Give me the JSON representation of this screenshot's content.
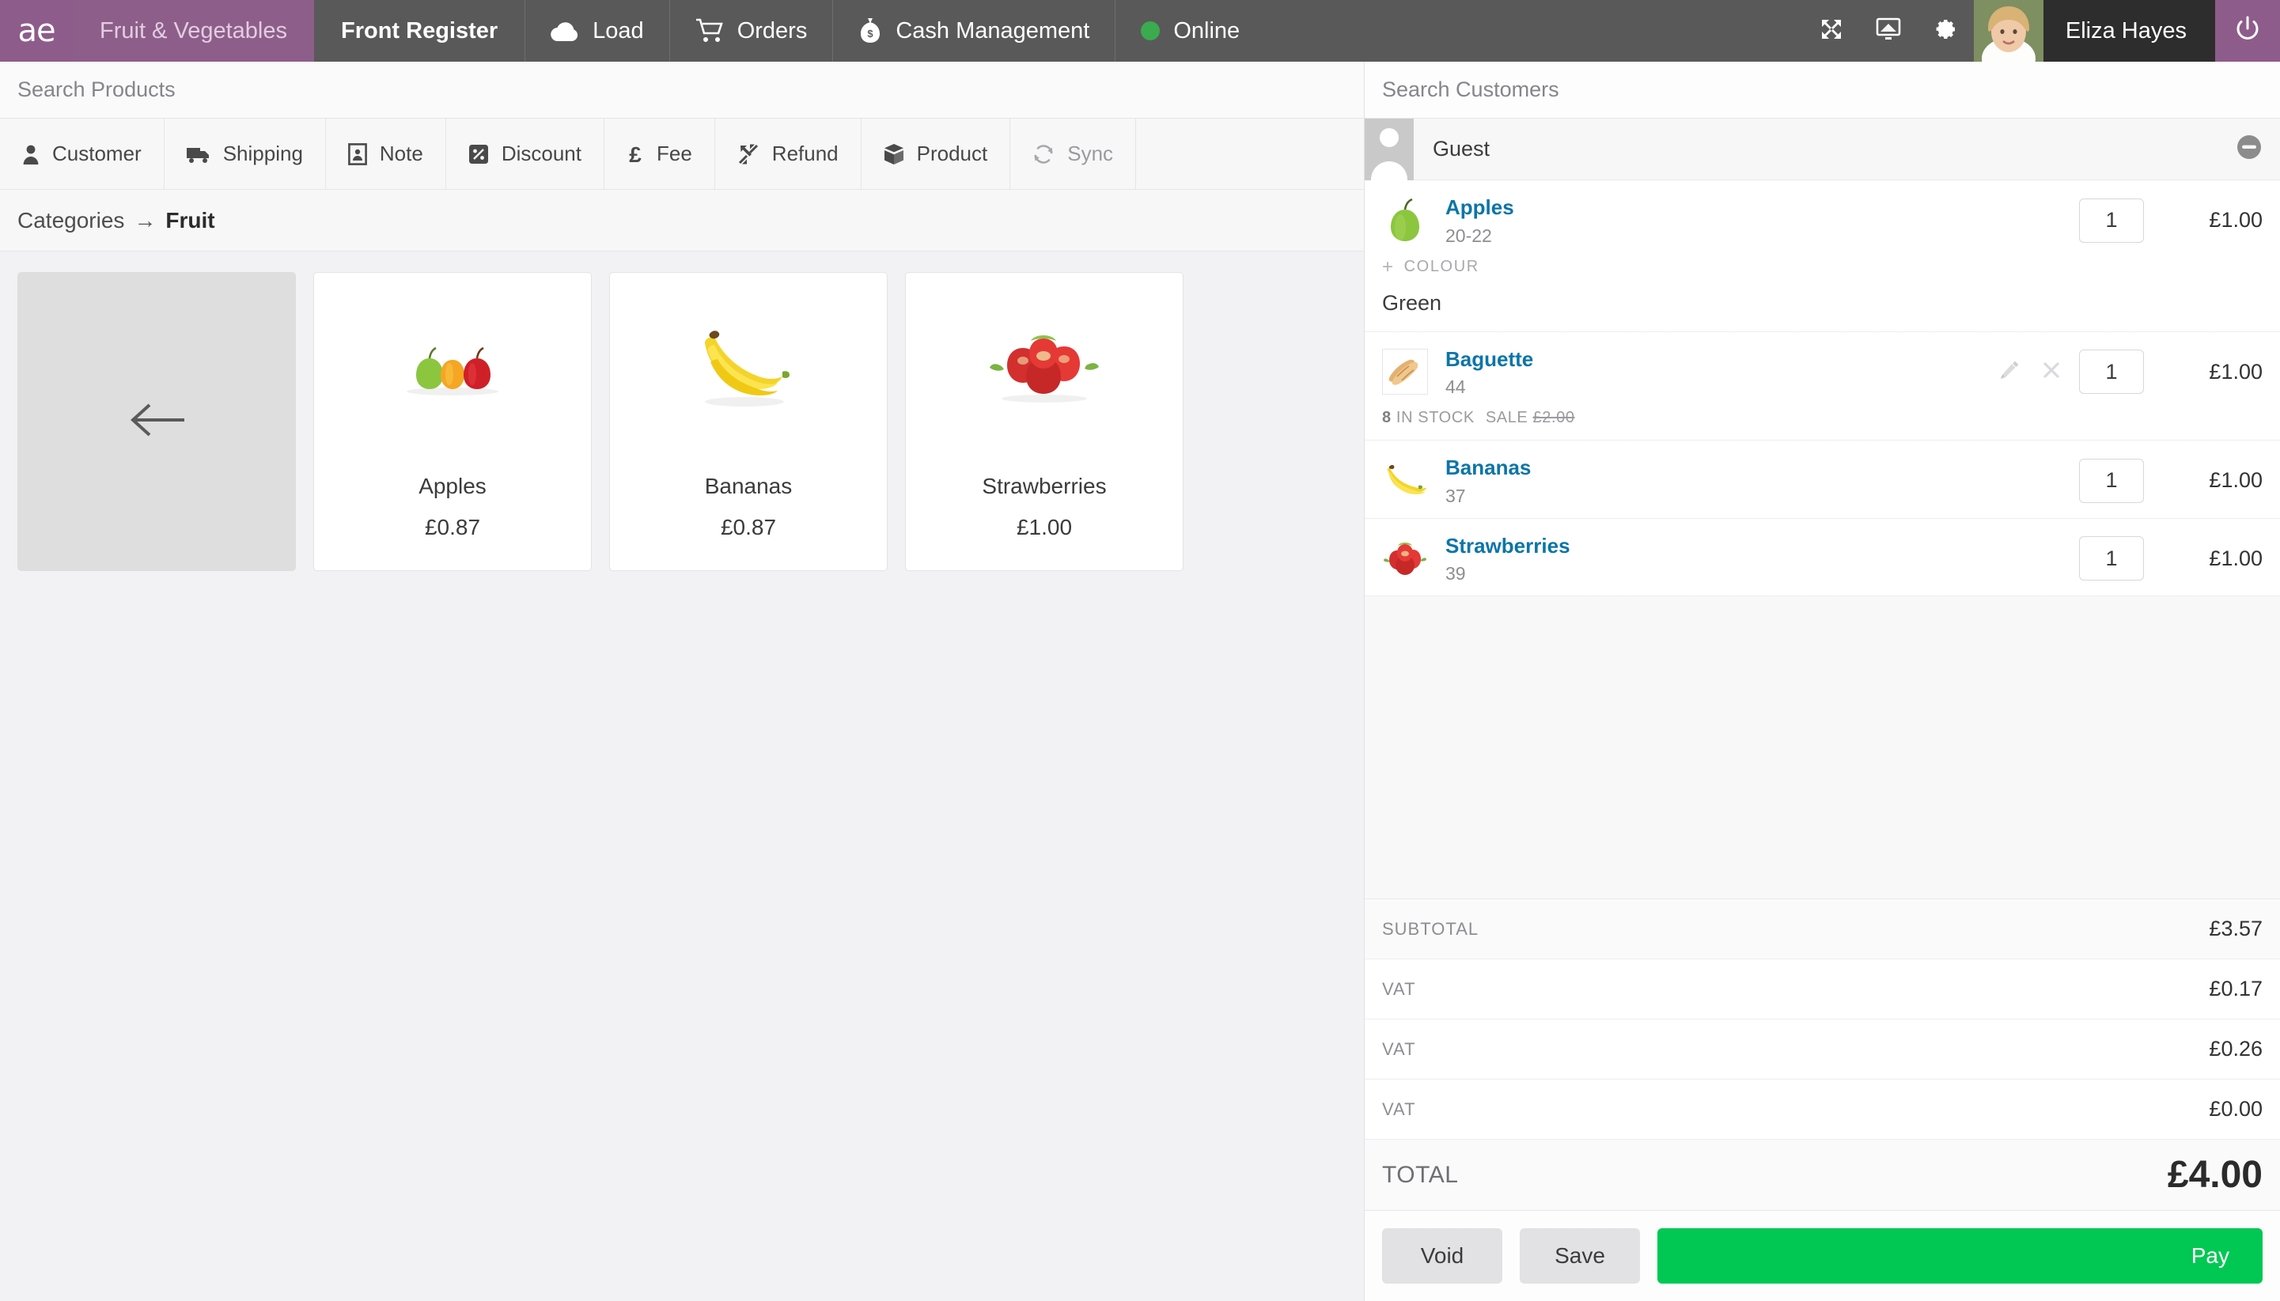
{
  "header": {
    "logo": "ae",
    "logo_icon": "logo-ae",
    "store_name": "Fruit & Vegetables",
    "register_name": "Front Register",
    "nav": [
      {
        "label": "Load",
        "icon": "cloud-icon"
      },
      {
        "label": "Orders",
        "icon": "shopping-cart-icon"
      },
      {
        "label": "Cash Management",
        "icon": "money-bag-icon"
      }
    ],
    "status": {
      "label": "Online",
      "icon": "status-dot-icon",
      "color": "#3aab4f"
    },
    "tools": [
      {
        "name": "fullscreen-icon"
      },
      {
        "name": "display-icon"
      },
      {
        "name": "gear-icon"
      }
    ],
    "user": {
      "name": "Eliza Hayes",
      "avatar": "user-avatar"
    },
    "power": {
      "icon": "power-icon"
    },
    "colors": {
      "brand_purple": "#8e5c8a",
      "bar_grey": "#595959",
      "user_tile": "#2d2d2d"
    }
  },
  "left": {
    "search_placeholder": "Search Products",
    "actions": [
      {
        "label": "Customer",
        "icon": "person-icon",
        "dim": false
      },
      {
        "label": "Shipping",
        "icon": "truck-icon",
        "dim": false
      },
      {
        "label": "Note",
        "icon": "note-card-icon",
        "dim": false
      },
      {
        "label": "Discount",
        "icon": "percent-tag-icon",
        "dim": false
      },
      {
        "label": "Fee",
        "icon": "pound-sign-icon",
        "dim": false
      },
      {
        "label": "Refund",
        "icon": "arrows-in-icon",
        "dim": false
      },
      {
        "label": "Product",
        "icon": "box-icon",
        "dim": false
      },
      {
        "label": "Sync",
        "icon": "sync-icon",
        "dim": true
      }
    ],
    "breadcrumb": {
      "root": "Categories",
      "separator": "→",
      "current": "Fruit"
    },
    "back_card": {
      "icon": "arrow-left-icon"
    },
    "products": [
      {
        "name": "Apples",
        "price": "£0.87",
        "thumb": "apples-photo"
      },
      {
        "name": "Bananas",
        "price": "£0.87",
        "thumb": "bananas-photo"
      },
      {
        "name": "Strawberries",
        "price": "£1.00",
        "thumb": "strawberries-photo"
      }
    ]
  },
  "right": {
    "search_placeholder": "Search Customers",
    "customer": {
      "name": "Guest",
      "remove_icon": "minus-circle-icon"
    },
    "cart": [
      {
        "name": "Apples",
        "sku": "20-22",
        "qty": "1",
        "price": "£1.00",
        "thumb": "green-apple-photo",
        "variation": {
          "plus": "+",
          "label": "COLOUR",
          "value": "Green"
        }
      },
      {
        "name": "Baguette",
        "sku": "44",
        "qty": "1",
        "price": "£1.00",
        "thumb": "baguette-photo",
        "actions": [
          {
            "name": "edit-pencil-icon"
          },
          {
            "name": "remove-x-icon"
          }
        ],
        "meta": {
          "stock_count": "8",
          "stock_label": "IN STOCK",
          "sale_label": "SALE",
          "sale_old_price": "£2.00"
        }
      },
      {
        "name": "Bananas",
        "sku": "37",
        "qty": "1",
        "price": "£1.00",
        "thumb": "bananas-photo"
      },
      {
        "name": "Strawberries",
        "sku": "39",
        "qty": "1",
        "price": "£1.00",
        "thumb": "strawberries-photo"
      }
    ],
    "totals": [
      {
        "label": "SUBTOTAL",
        "value": "£3.57"
      },
      {
        "label": "VAT",
        "value": "£0.17"
      },
      {
        "label": "VAT",
        "value": "£0.26"
      },
      {
        "label": "VAT",
        "value": "£0.00"
      }
    ],
    "grand_total": {
      "label": "TOTAL",
      "value": "£4.00"
    },
    "footer": {
      "void_label": "Void",
      "save_label": "Save",
      "pay_label": "Pay",
      "pay_color": "#00c853"
    }
  }
}
